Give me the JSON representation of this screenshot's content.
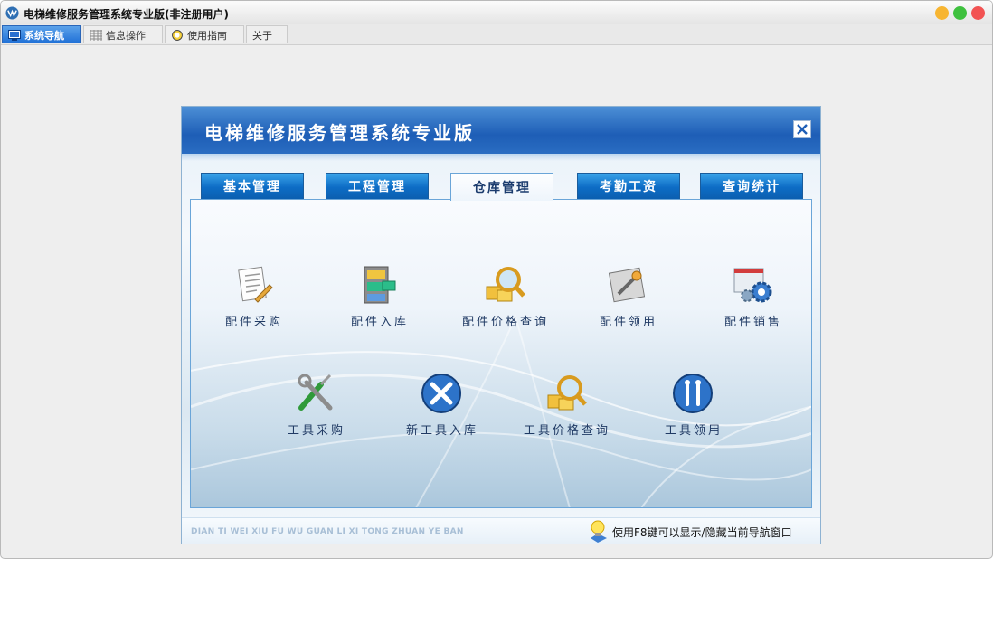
{
  "window": {
    "title": "电梯维修服务管理系统专业版(非注册用户)",
    "controls": {
      "min_color": "#f7b531",
      "max_color": "#3fc13f",
      "close_color": "#f25353"
    }
  },
  "tabs": [
    {
      "label": "系统导航",
      "icon": "monitor-icon",
      "active": true
    },
    {
      "label": "信息操作",
      "icon": "grid-icon",
      "active": false
    },
    {
      "label": "使用指南",
      "icon": "help-icon",
      "active": false
    },
    {
      "label": "关于",
      "icon": "",
      "active": false
    }
  ],
  "panel": {
    "title": "电梯维修服务管理系统专业版",
    "close_icon": "close-icon",
    "module_tabs": [
      {
        "label": "基本管理",
        "active": false
      },
      {
        "label": "工程管理",
        "active": false
      },
      {
        "label": "仓库管理",
        "active": true
      },
      {
        "label": "考勤工资",
        "active": false
      },
      {
        "label": "查询统计",
        "active": false
      }
    ],
    "items": [
      {
        "label": "配件采购",
        "icon": "document-pen-icon"
      },
      {
        "label": "配件入库",
        "icon": "cabinet-icon"
      },
      {
        "label": "配件价格查询",
        "icon": "search-boxes-icon"
      },
      {
        "label": "配件领用",
        "icon": "wrench-panel-icon"
      },
      {
        "label": "配件销售",
        "icon": "gear-window-icon"
      },
      {
        "label": "工具采购",
        "icon": "tools-crossed-icon"
      },
      {
        "label": "新工具入库",
        "icon": "tools-globe-icon"
      },
      {
        "label": "工具价格查询",
        "icon": "search-boxes-icon"
      },
      {
        "label": "工具领用",
        "icon": "tools-globe-icon"
      }
    ],
    "footer": {
      "pinyin": "DIAN TI WEI XIU FU WU GUAN LI XI TONG ZHUAN YE BAN",
      "tip": "使用F8键可以显示/隐藏当前导航窗口",
      "tip_icon": "lightbulb-icon"
    }
  },
  "colors": {
    "header_blue": "#1e5eb6",
    "tab_blue": "#0d6cc5",
    "label_text": "#203a64"
  }
}
